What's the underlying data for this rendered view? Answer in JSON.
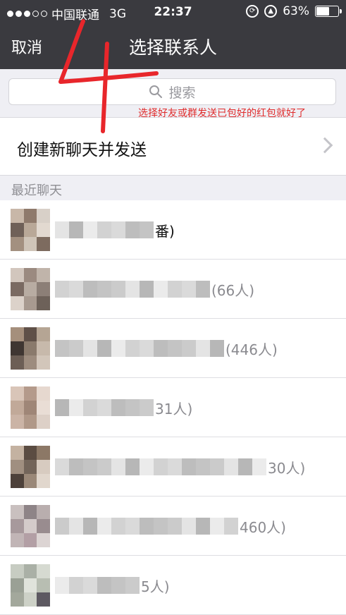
{
  "status_bar": {
    "carrier": "中国联通",
    "network": "3G",
    "time": "22:37",
    "battery": "63%",
    "battery_level": 0.63
  },
  "nav": {
    "cancel": "取消",
    "title": "选择联系人"
  },
  "search": {
    "placeholder": "搜索"
  },
  "annotation": {
    "text": "选择好友或群发送已包好的红包就好了",
    "color": "#e02d2d"
  },
  "create_chat": {
    "label": "创建新聊天并发送"
  },
  "section_recent": "最近聊天",
  "chats": [
    {
      "visible_text": "番)",
      "dark": true
    },
    {
      "visible_text": "(66人)",
      "dark": false
    },
    {
      "visible_text": "(446人)",
      "dark": false
    },
    {
      "visible_text": "31人)",
      "dark": false
    },
    {
      "visible_text": "30人)",
      "dark": false
    },
    {
      "visible_text": "460人)",
      "dark": false
    },
    {
      "visible_text": "5人)",
      "dark": false
    }
  ],
  "colors": {
    "bar": "#3a3a3f",
    "background": "#efeff4"
  }
}
